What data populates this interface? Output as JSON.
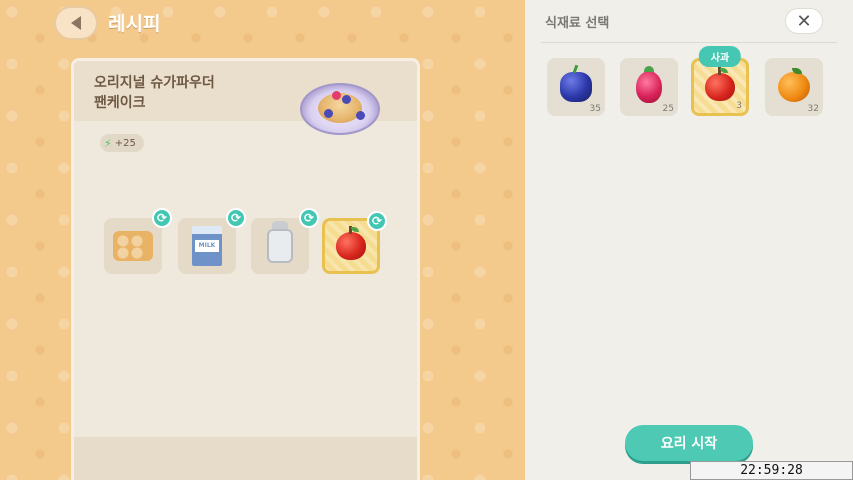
{
  "header": {
    "title": "레시피"
  },
  "recipe": {
    "name": "오리지널 슈가파우더\n팬케이크",
    "energy": "+25",
    "ingredients": [
      {
        "name": "egg-carton",
        "swappable": true
      },
      {
        "name": "milk-carton",
        "swappable": true,
        "label": "MILK"
      },
      {
        "name": "sugar-jar",
        "swappable": true
      },
      {
        "name": "apple",
        "swappable": true,
        "selected": true
      }
    ]
  },
  "panel": {
    "title": "식재료 선택",
    "items": [
      {
        "name": "blackberry",
        "count": "35"
      },
      {
        "name": "raspberry",
        "count": "25"
      },
      {
        "name": "apple",
        "count": "3",
        "selected": true,
        "tooltip": "사과"
      },
      {
        "name": "orange",
        "count": "32"
      }
    ],
    "cook_button": "요리 시작"
  },
  "overlay": {
    "clock": "22:59:28"
  },
  "colors": {
    "accent": "#4ecab4",
    "selected_border": "#e9c150",
    "bg_orange": "#f3c98c"
  }
}
